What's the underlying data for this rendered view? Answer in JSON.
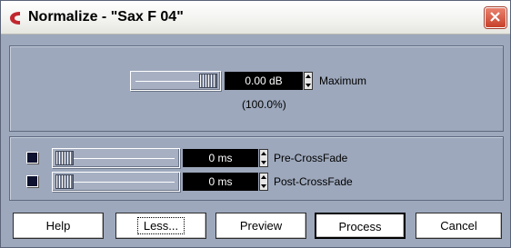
{
  "window": {
    "title": "Normalize - \"Sax F 04\""
  },
  "maximum": {
    "value": "0.00 dB",
    "label": "Maximum",
    "percent": "(100.0%)",
    "slider_level": 1.0
  },
  "crossfades": [
    {
      "value": "0 ms",
      "label": "Pre-CrossFade",
      "slider_level": 0.0
    },
    {
      "value": "0 ms",
      "label": "Post-CrossFade",
      "slider_level": 0.0
    }
  ],
  "buttons": {
    "help": "Help",
    "less": "Less...",
    "preview": "Preview",
    "process": "Process",
    "cancel": "Cancel"
  },
  "colors": {
    "dialog_bg": "#9da8bc",
    "value_box_bg": "#000000",
    "checkbox_fill": "#0e1230",
    "close_button": "#c7402a"
  },
  "icons": {
    "app": "cubase-logo-icon",
    "close": "close-icon"
  }
}
